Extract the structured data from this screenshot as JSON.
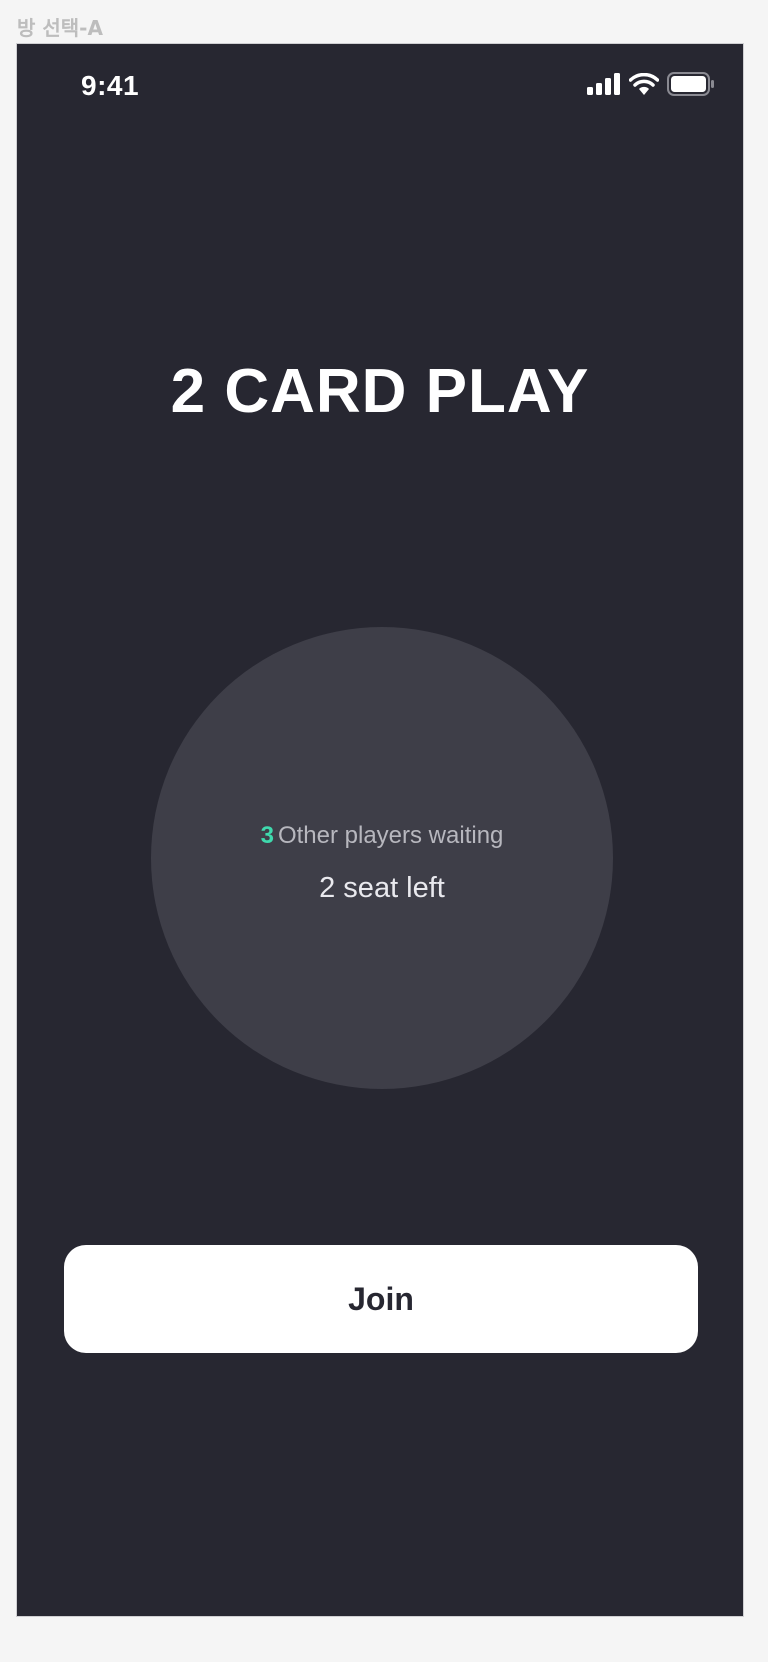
{
  "frame": {
    "label": "방 선택-A"
  },
  "status_bar": {
    "time": "9:41",
    "icons": [
      "cellular-signal-icon",
      "wifi-icon",
      "battery-icon"
    ]
  },
  "header": {
    "title": "2 CARD PLAY"
  },
  "room": {
    "waiting_count": "3",
    "waiting_label": "Other players waiting",
    "seats_left": "2 seat left"
  },
  "actions": {
    "join_label": "Join"
  },
  "colors": {
    "background": "#272731",
    "circle": "#3e3e48",
    "accent": "#3fd9ad",
    "button": "#ffffff"
  }
}
